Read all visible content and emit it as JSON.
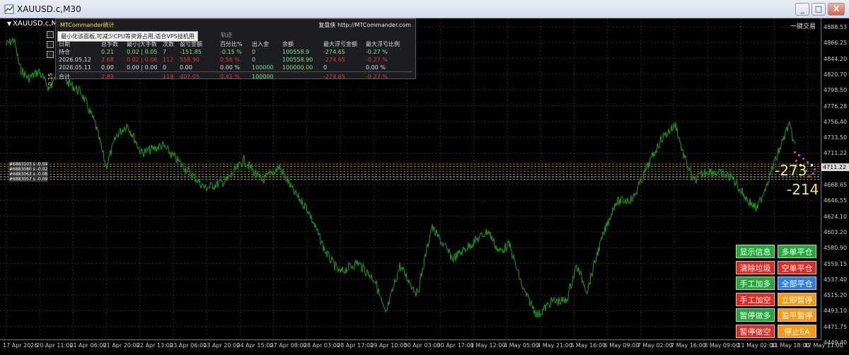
{
  "window": {
    "title": "XAUUSD.c,M30",
    "min_label": "_",
    "max_label": "□",
    "close_label": "X"
  },
  "chart": {
    "symbol_label": "XAUUSD.c,M30",
    "oneclick_label": "一键交易",
    "vertical_label": "0.15",
    "current_price": "4711.22",
    "line_color": "#14a014",
    "price_ticks": [
      "4888.53",
      "4866.25",
      "4844.20",
      "4820.70",
      "4798.50",
      "4776.28",
      "4756.40",
      "4733.50",
      "4711.22",
      "4690.75",
      "4668.65",
      "4646.55",
      "4624.10",
      "4603.20",
      "4580.90",
      "4559.15",
      "4537.40",
      "4515.20",
      "4493.10",
      "4471.75",
      "4449.40"
    ],
    "time_ticks": [
      "17 Apr 2026",
      "20 Apr 11:00",
      "21 Apr 06:00",
      "21 Apr 20:00",
      "22 Apr 13:00",
      "23 Apr 06:00",
      "23 Apr 20:00",
      "24 Apr 15:00",
      "27 Apr 08:00",
      "28 Apr 03:00",
      "28 Apr 17:00",
      "29 Apr 10:00",
      "30 Apr 03:00",
      "30 Apr 17:00",
      "1 May 12:00",
      "4 May 05:00",
      "4 May 21:00",
      "5 May 16:00",
      "6 May 09:00",
      "7 May 02:00",
      "7 May 16:00",
      "8 May 09:00",
      "11 May 02:00",
      "11 May 18:00",
      "12 May 11:00"
    ],
    "hline_tags": [
      "#6883103 s -0.04",
      "#6883080 s -0.02",
      "#6883063 s -0.08",
      "#6883057 s -0.09"
    ],
    "big_numbers": [
      "-273",
      "-214"
    ]
  },
  "stats_panel": {
    "title": "MTCommander统计",
    "site": "复盘侠 http://MTCommander.com",
    "tooltip": "最小化该面板,可减少CPU等资源占用,适合VPS挂机用",
    "trail_label": "轨迹",
    "side_icons": [
      "minimize-icon",
      "restore-icon",
      "close-icon"
    ],
    "headers": [
      "日期",
      "总手数",
      "最小|大手数",
      "次数",
      "盈亏金额",
      "百分比%",
      "出入金",
      "余额",
      "最大浮亏金额",
      "最大浮亏比例"
    ],
    "rows": [
      {
        "cls": "r-hold",
        "cells": [
          "持仓",
          "0.21",
          "0.02 | 0.05",
          "7",
          "-151.85",
          "-0.15 %",
          "0",
          "100558.9",
          "-274.65",
          "-0.27 %"
        ]
      },
      {
        "cls": "r-d1",
        "cells": [
          "2026.05.12",
          "2.68",
          "0.02 | 0.06",
          "112",
          "558.90",
          "0.56 %",
          "0",
          "100558.90",
          "-274.65",
          "-0.27 %"
        ]
      },
      {
        "cls": "r-d2",
        "cells": [
          "2026.05.11",
          "0.00",
          "0.00 | 0.00",
          "0",
          "0.00",
          "0.00 %",
          "100000",
          "100000.00",
          "0",
          "0.00 %"
        ]
      },
      {
        "cls": "r-total",
        "cells": [
          "合计",
          "2.89",
          "",
          "119",
          "407.05",
          "0.41 %",
          "100000",
          "",
          "-274.65",
          "-0.27 %"
        ]
      }
    ]
  },
  "buttons": [
    {
      "label": "显示信息",
      "color": "g",
      "name": "show-info-button"
    },
    {
      "label": "多单平仓",
      "color": "g",
      "name": "close-long-button"
    },
    {
      "label": "清除垃圾",
      "color": "r",
      "name": "clear-junk-button"
    },
    {
      "label": "空单平仓",
      "color": "r",
      "name": "close-short-button"
    },
    {
      "label": "手工加多",
      "color": "g",
      "name": "manual-add-long-button"
    },
    {
      "label": "全部平仓",
      "color": "b",
      "name": "close-all-button"
    },
    {
      "label": "手工加空",
      "color": "r",
      "name": "manual-add-short-button"
    },
    {
      "label": "立即暂停",
      "color": "o",
      "name": "pause-now-button"
    },
    {
      "label": "暂停做多",
      "color": "g",
      "name": "pause-long-button"
    },
    {
      "label": "盈平暂停",
      "color": "o",
      "name": "profit-close-pause-button"
    },
    {
      "label": "暂停做空",
      "color": "r",
      "name": "pause-short-button"
    },
    {
      "label": "停止EA",
      "color": "o",
      "name": "stop-ea-button"
    }
  ]
}
